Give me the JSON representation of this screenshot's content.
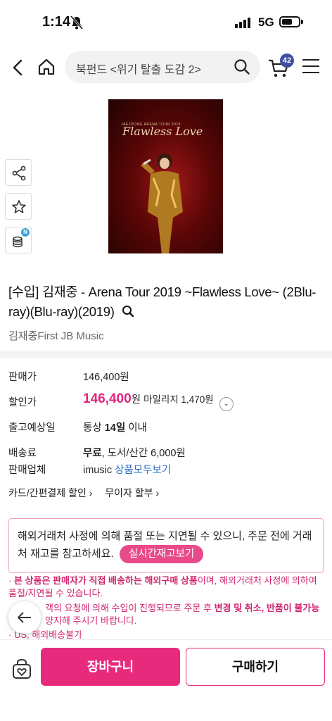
{
  "status_bar": {
    "time": "1:14",
    "network": "5G"
  },
  "header": {
    "search_placeholder": "북펀드 <위기 탈출 도감 2>",
    "cart_count": "42"
  },
  "product_image": {
    "tour_text": "JAEJOONG ARENA TOUR 2019",
    "title_text": "Flawless Love"
  },
  "side_badge": "N",
  "product": {
    "title": "[수입] 김재중 - Arena Tour 2019 ~Flawless Love~ (2Blu-ray)(Blu-ray)(2019)",
    "artist": "김재중First JB Music"
  },
  "info": {
    "list_price_label": "판매가",
    "list_price": "146,400원",
    "sale_price_label": "할인가",
    "sale_price": "146,400",
    "sale_price_unit": "원",
    "mileage": "마일리지 1,470원",
    "ship_date_label": "출고예상일",
    "ship_date_prefix": "통상",
    "ship_date_days": "14일",
    "ship_date_suffix": "이내",
    "fee_label": "배송료",
    "fee_free": "무료",
    "fee_detail": ", 도서/산간 6,000원",
    "seller_label": "판매업체",
    "seller": "imusic",
    "seller_link": "상품모두보기"
  },
  "links": {
    "card_discount": "카드/간편결제 할인",
    "installment": "무이자 할부"
  },
  "notice": {
    "text": "해외거래처 사정에 의해 품절 또는 지연될 수 있으니, 주문 전에 거래처 재고를 참고하세요.",
    "stock_button": "실시간재고보기"
  },
  "bullets": {
    "b1_prefix": "본 상품은",
    "b1_bold": "판매자가 직접 배송하는 해외구매 상품",
    "b1_rest": "이며, 해외거래처 사정에 의하여 품절/지연될 수 있습니다.",
    "b2_prefix": "객의 요청에 의해 수입이 진행되므로 주문 후",
    "b2_bold": "변경 및 취소, 반품이 불가능",
    "b2_rest": "양지해 주시기 바랍니다.",
    "b3": "US, 해외배송불가"
  },
  "bottom": {
    "cart_button": "장바구니",
    "buy_button": "구매하기"
  },
  "colors": {
    "accent": "#e82a7d",
    "badge": "#3d4f9f",
    "link": "#2a6fc4"
  }
}
